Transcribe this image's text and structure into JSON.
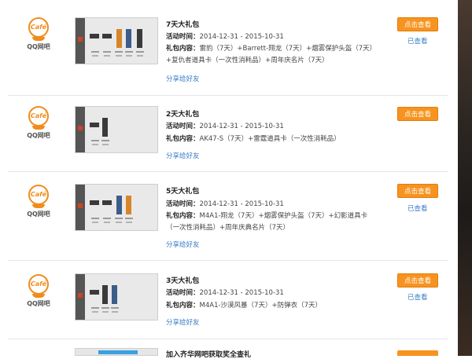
{
  "logo": {
    "badge": "Café",
    "brand": "QQ网吧"
  },
  "common": {
    "time_label": "活动时间：",
    "content_label": "礼包内容：",
    "share_label": "分享给好友",
    "view_button": "点击查看",
    "viewed_label": "已查看"
  },
  "packages": [
    {
      "title": "7天大礼包",
      "time": "2014-12-31 - 2015-10-31",
      "content": "雷豹（7天）+Barrett-翔龙（7天）+烟雾保护头盔（7天）+复仇者道具卡（一次性消耗品）+周年庆名片（7天）",
      "viewed": true
    },
    {
      "title": "2天大礼包",
      "time": "2014-12-31 - 2015-10-31",
      "content": "AK47-S（7天）+雷霆道具卡（一次性消耗品）",
      "viewed": false
    },
    {
      "title": "5天大礼包",
      "time": "2014-12-31 - 2015-10-31",
      "content": "M4A1-翔龙（7天）+烟雾保护头盔（7天）+幻影道具卡（一次性消耗品）+周年庆典名片（7天）",
      "viewed": true
    },
    {
      "title": "3天大礼包",
      "time": "2014-12-31 - 2015-10-31",
      "content": "M4A1-沙漠风暴（7天）+防弹衣（7天）",
      "viewed": true
    }
  ],
  "partial_item": {
    "title": "加入齐华网吧获取奖全查礼"
  }
}
